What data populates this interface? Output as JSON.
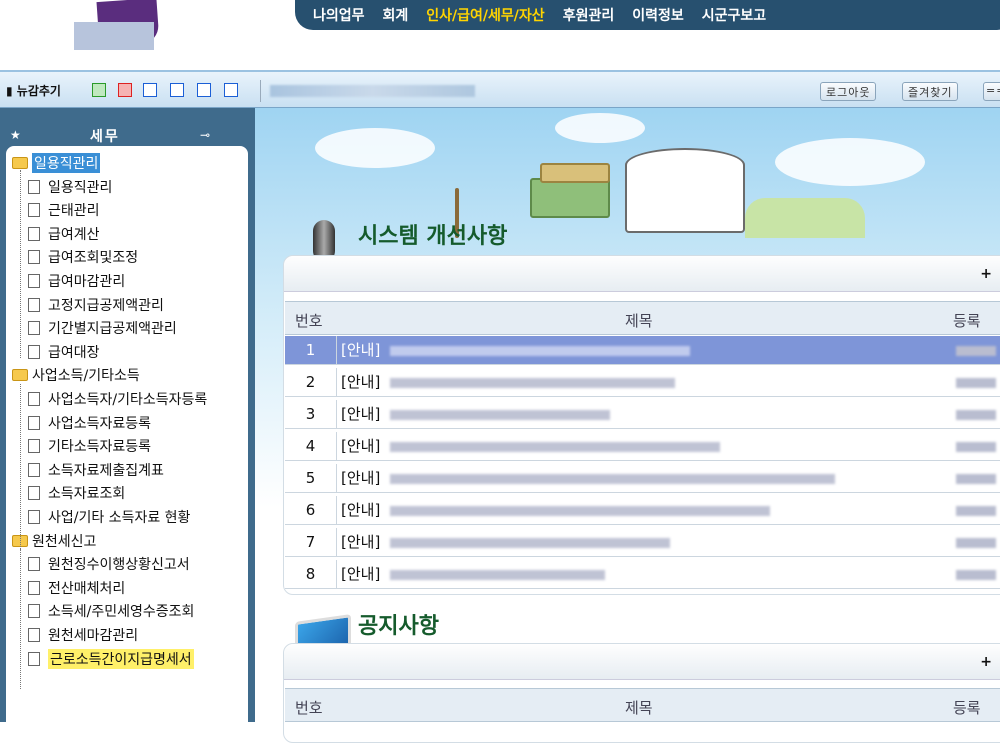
{
  "top_menu": [
    "나의업무",
    "회계",
    "인사/급여/세무/자산",
    "후원관리",
    "이력정보",
    "시군구보고"
  ],
  "toolbar": {
    "news_add": "뉴감추기",
    "logout": "로그아웃",
    "favorites": "즐겨찾기",
    "dropdown": "=="
  },
  "sidebar": {
    "title": "세무",
    "tree": [
      {
        "type": "folder",
        "label": "일용직관리",
        "highlight": "blue"
      },
      {
        "type": "doc",
        "label": "일용직관리"
      },
      {
        "type": "doc",
        "label": "근태관리"
      },
      {
        "type": "doc",
        "label": "급여계산"
      },
      {
        "type": "doc",
        "label": "급여조회및조정"
      },
      {
        "type": "doc",
        "label": "급여마감관리"
      },
      {
        "type": "doc",
        "label": "고정지급공제액관리"
      },
      {
        "type": "doc",
        "label": "기간별지급공제액관리"
      },
      {
        "type": "doc",
        "label": "급여대장"
      },
      {
        "type": "folder",
        "label": "사업소득/기타소득"
      },
      {
        "type": "doc",
        "label": "사업소득자/기타소득자등록"
      },
      {
        "type": "doc",
        "label": "사업소득자료등록"
      },
      {
        "type": "doc",
        "label": "기타소득자료등록"
      },
      {
        "type": "doc",
        "label": "소득자료제출집계표"
      },
      {
        "type": "doc",
        "label": "소득자료조회"
      },
      {
        "type": "doc",
        "label": "사업/기타 소득자료 현황"
      },
      {
        "type": "folder",
        "label": "원천세신고"
      },
      {
        "type": "doc",
        "label": "원천징수이행상황신고서"
      },
      {
        "type": "doc",
        "label": "전산매체처리"
      },
      {
        "type": "doc",
        "label": "소득세/주민세영수증조회"
      },
      {
        "type": "doc",
        "label": "원천세마감관리"
      },
      {
        "type": "doc",
        "label": "근로소득간이지급명세서",
        "highlight": "yellow"
      }
    ]
  },
  "system": {
    "title": "시스템 개선사항",
    "plus": "+",
    "headers": {
      "num": "번호",
      "subject": "제목",
      "date": "등록"
    },
    "rows": [
      {
        "num": "1",
        "prefix": "[안내]"
      },
      {
        "num": "2",
        "prefix": "[안내]"
      },
      {
        "num": "3",
        "prefix": "[안내]"
      },
      {
        "num": "4",
        "prefix": "[안내]"
      },
      {
        "num": "5",
        "prefix": "[안내]"
      },
      {
        "num": "6",
        "prefix": "[안내]"
      },
      {
        "num": "7",
        "prefix": "[안내]"
      },
      {
        "num": "8",
        "prefix": "[안내]"
      }
    ]
  },
  "notice": {
    "title": "공지사항",
    "plus": "+",
    "headers": {
      "num": "번호",
      "subject": "제목",
      "date": "등록"
    }
  },
  "colors": {
    "menubar": "#27506f",
    "menu_highlight": "#ffd400",
    "sidebar": "#3f6b8c",
    "selected_row": "#7e95d8",
    "tree_highlight_blue": "#3a8fd6",
    "tree_highlight_yellow": "#fff069"
  }
}
